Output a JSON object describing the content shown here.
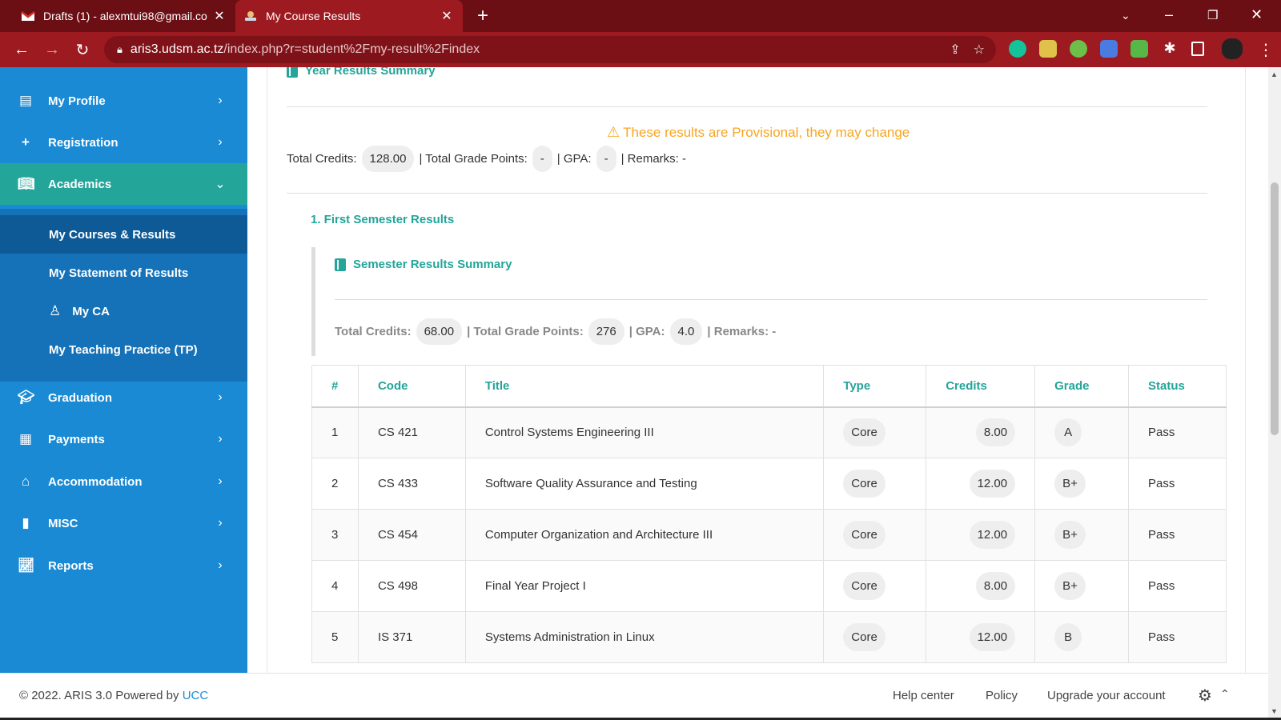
{
  "browser": {
    "tabs": [
      {
        "title": "Drafts (1) - alexmtui98@gmail.co",
        "icon": "gmail-icon"
      },
      {
        "title": "My Course Results",
        "icon": "aris-icon"
      }
    ],
    "url_host": "aris3.udsm.ac.tz",
    "url_path": "/index.php?r=student%2Fmy-result%2Findex"
  },
  "sidebar": {
    "items": [
      {
        "label": "My Profile",
        "icon": "profile-icon"
      },
      {
        "label": "Registration",
        "icon": "plus-icon"
      },
      {
        "label": "Academics",
        "icon": "book-open-icon"
      },
      {
        "label": "Graduation",
        "icon": "graduation-cap-icon"
      },
      {
        "label": "Payments",
        "icon": "money-icon"
      },
      {
        "label": "Accommodation",
        "icon": "home-icon"
      },
      {
        "label": "MISC",
        "icon": "mouse-icon"
      },
      {
        "label": "Reports",
        "icon": "chart-icon"
      }
    ],
    "academics_sub": [
      {
        "label": "My Courses & Results"
      },
      {
        "label": "My Statement of Results"
      },
      {
        "label": "My CA"
      },
      {
        "label": "My Teaching Practice (TP)"
      }
    ]
  },
  "main": {
    "year_summary_title": "Year Results Summary",
    "provisional_warning": "These results are Provisional, they may change",
    "year_stats": {
      "credits_label": "Total Credits:",
      "credits": "128.00",
      "grade_points_label": "| Total Grade Points:",
      "grade_points": "-",
      "gpa_label": "| GPA:",
      "gpa": "-",
      "remarks_label": "| Remarks: -"
    },
    "semester_title": "1. First Semester Results",
    "semester_summary_title": "Semester Results Summary",
    "semester_stats": {
      "credits_label": "Total Credits:",
      "credits": "68.00",
      "grade_points_label": "| Total Grade Points:",
      "grade_points": "276",
      "gpa_label": "| GPA:",
      "gpa": "4.0",
      "remarks_label": "| Remarks: -"
    },
    "table": {
      "headers": [
        "#",
        "Code",
        "Title",
        "Type",
        "Credits",
        "Grade",
        "Status"
      ],
      "rows": [
        {
          "n": "1",
          "code": "CS 421",
          "title": "Control Systems Engineering III",
          "type": "Core",
          "credits": "8.00",
          "grade": "A",
          "status": "Pass"
        },
        {
          "n": "2",
          "code": "CS 433",
          "title": "Software Quality Assurance and Testing",
          "type": "Core",
          "credits": "12.00",
          "grade": "B+",
          "status": "Pass"
        },
        {
          "n": "3",
          "code": "CS 454",
          "title": "Computer Organization and Architecture III",
          "type": "Core",
          "credits": "12.00",
          "grade": "B+",
          "status": "Pass"
        },
        {
          "n": "4",
          "code": "CS 498",
          "title": "Final Year Project I",
          "type": "Core",
          "credits": "8.00",
          "grade": "B+",
          "status": "Pass"
        },
        {
          "n": "5",
          "code": "IS 371",
          "title": "Systems Administration in Linux",
          "type": "Core",
          "credits": "12.00",
          "grade": "B",
          "status": "Pass"
        }
      ]
    }
  },
  "footer": {
    "copyright": "© 2022. ARIS 3.0 Powered by",
    "powered_link": "UCC",
    "links": [
      "Help center",
      "Policy",
      "Upgrade your account"
    ]
  },
  "colors": {
    "accent": "#23a59a",
    "sidebar": "#1a8ad4",
    "browser": "#9c1a20",
    "warning": "#f5a623"
  }
}
